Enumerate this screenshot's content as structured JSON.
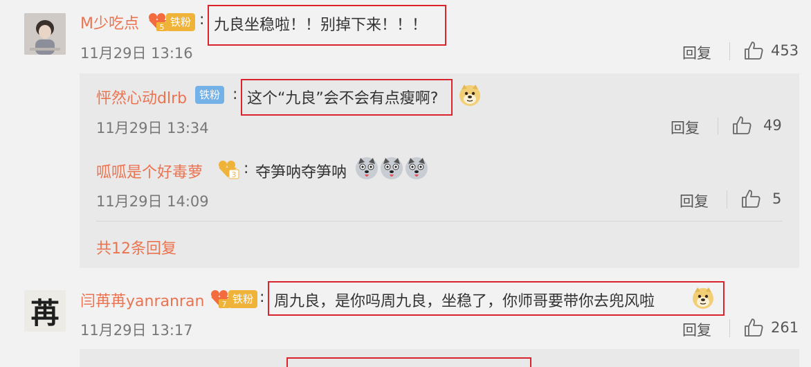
{
  "comments": [
    {
      "user": "M少吃点",
      "level": "5",
      "badge": "铁粉",
      "text": "九良坐稳啦！！别掉下来！！！",
      "time": "11月29日 13:16",
      "reply_label": "回复",
      "likes": "453"
    },
    {
      "user": "闫苒苒yanranran",
      "level": "7",
      "badge": "铁粉",
      "text": "周九良，是你吗周九良，坐稳了，你师哥要带你去兜风啦",
      "time": "11月29日 13:17",
      "reply_label": "回复",
      "likes": "261"
    }
  ],
  "replies": [
    {
      "user": "怦然心动dlrb",
      "badge": "铁粉",
      "text": "这个“九良”会不会有点瘦啊?",
      "time": "11月29日 13:34",
      "reply_label": "回复",
      "likes": "49"
    },
    {
      "user": "呱呱是个好毒萝",
      "level": "3",
      "text": "夺笋呐夺笋呐",
      "time": "11月29日 14:09",
      "reply_label": "回复",
      "likes": "5"
    }
  ],
  "more_replies": "共12条回复",
  "avatar2_glyph": "苒",
  "colon": ":",
  "colors": {
    "username": "#eb7350",
    "highlight": "#d9232d",
    "fan_badge": "#f0b33a",
    "fan_badge_blue": "#74b1e6"
  },
  "icons": [
    "thumbs-up-icon",
    "crown-icon",
    "doge-emoji",
    "husky-emoji"
  ]
}
